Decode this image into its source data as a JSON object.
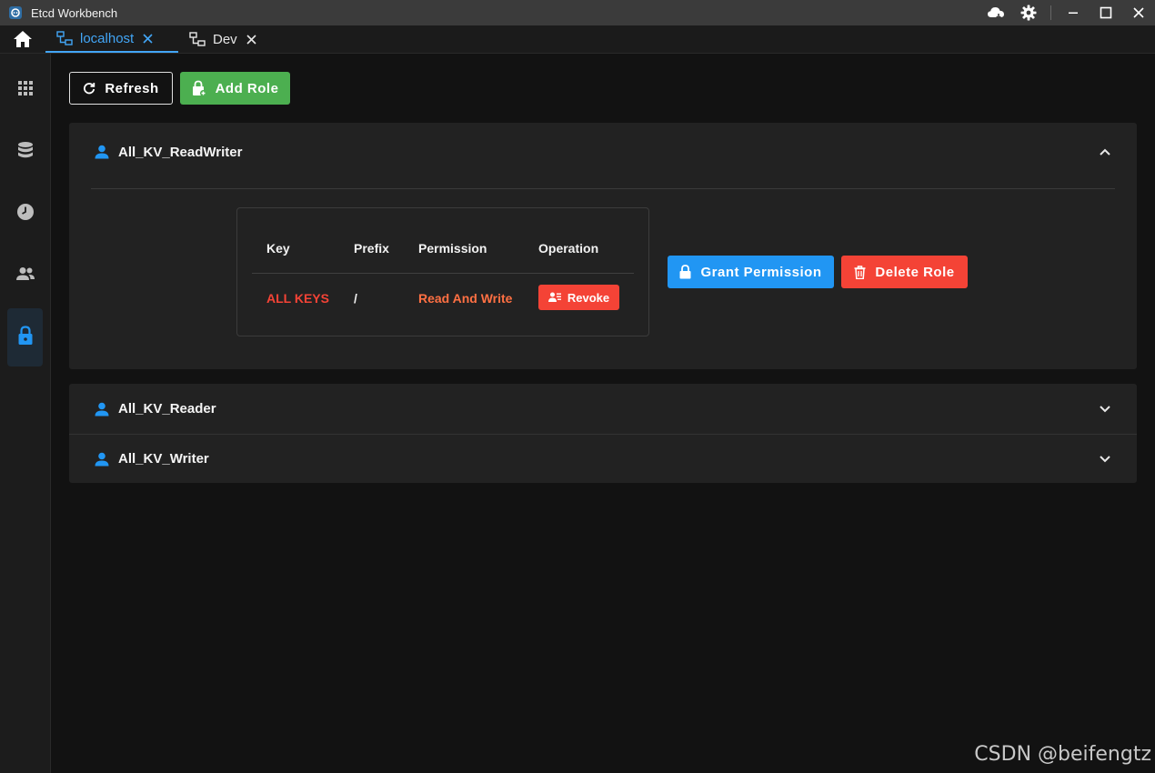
{
  "window": {
    "title": "Etcd Workbench"
  },
  "tabs": [
    {
      "label": "localhost",
      "active": true,
      "icon": "server-network-icon"
    },
    {
      "label": "Dev",
      "active": false,
      "icon": "server-network-icon"
    }
  ],
  "sidebar": {
    "items": [
      {
        "name": "dashboard",
        "icon": "grid-icon",
        "active": false
      },
      {
        "name": "keys",
        "icon": "database-icon",
        "active": false
      },
      {
        "name": "leases",
        "icon": "clock-icon",
        "active": false
      },
      {
        "name": "users",
        "icon": "users-icon",
        "active": false
      },
      {
        "name": "roles",
        "icon": "lock-icon",
        "active": true
      }
    ]
  },
  "toolbar": {
    "refresh_label": "Refresh",
    "add_role_label": "Add Role"
  },
  "roles": [
    {
      "name": "All_KV_ReadWriter",
      "expanded": true,
      "table": {
        "headers": [
          "Key",
          "Prefix",
          "Permission",
          "Operation"
        ],
        "rows": [
          {
            "key": "ALL KEYS",
            "prefix": "/",
            "permission": "Read And Write",
            "operation": "Revoke"
          }
        ]
      },
      "grant_label": "Grant Permission",
      "delete_label": "Delete Role"
    },
    {
      "name": "All_KV_Reader",
      "expanded": false
    },
    {
      "name": "All_KV_Writer",
      "expanded": false
    }
  ],
  "colors": {
    "accent": "#42a5f5",
    "success": "#4caf50",
    "danger": "#f44336",
    "warning": "#ff7043",
    "background": "#121212",
    "panel": "#222222"
  },
  "watermark": "CSDN @beifengtz"
}
